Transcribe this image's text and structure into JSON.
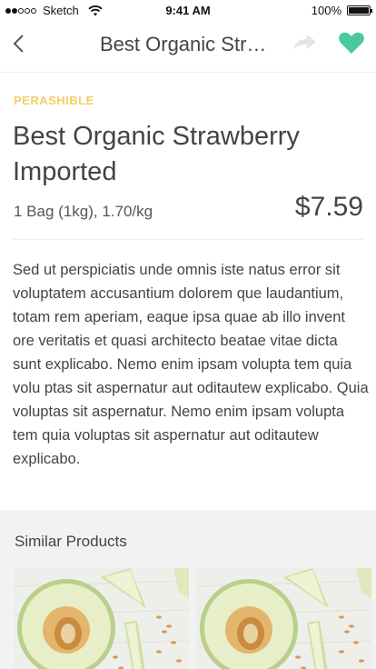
{
  "status_bar": {
    "carrier": "Sketch",
    "time": "9:41 AM",
    "battery": "100%",
    "battery_level": 1.0,
    "signal_filled": 2,
    "signal_total": 5
  },
  "nav": {
    "title": "Best Organic Stra...",
    "back_icon": "chevron-left-icon",
    "share_icon": "share-arrow-icon",
    "favorite_icon": "heart-icon",
    "favorite_color": "#48c9a2"
  },
  "product": {
    "tag": "PERASHIBLE",
    "tag_color": "#f5cf64",
    "title": "Best Organic Strawberry Imported",
    "meta": "1 Bag (1kg), 1.70/kg",
    "price": "$7.59",
    "description": "Sed ut perspiciatis unde omnis iste natus error sit voluptatem accusantium dolorem que laudantium, totam rem aperiam, eaque ipsa quae ab illo invent ore veritatis et quasi architecto beatae vitae dicta sunt explicabo. Nemo enim ipsam volupta tem quia volu ptas sit aspernatur aut oditautew explicabo. Quia voluptas sit aspernatur. Nemo enim ipsam volupta tem quia voluptas sit aspernatur aut oditautew explicabo."
  },
  "similar": {
    "title": "Similar Products",
    "items": [
      {
        "image": "melon-image"
      },
      {
        "image": "melon-image"
      }
    ]
  }
}
